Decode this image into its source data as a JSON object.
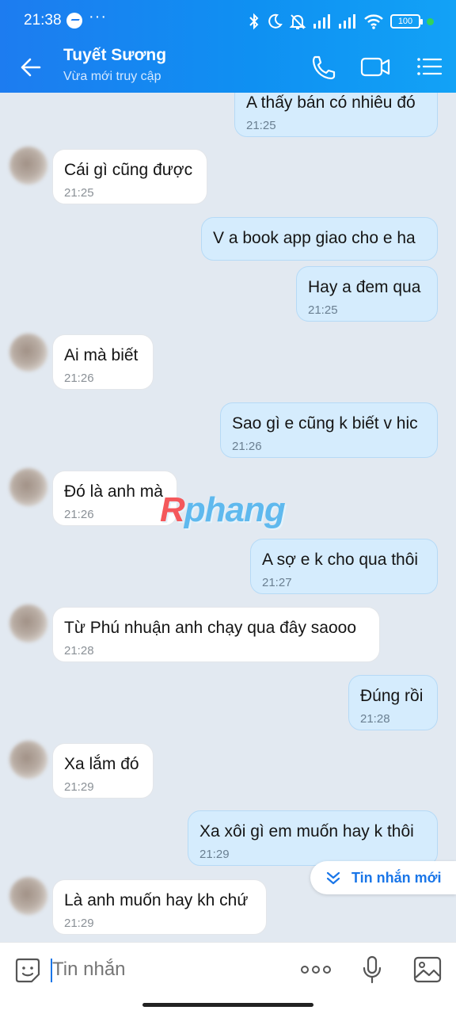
{
  "status_bar": {
    "time": "21:38",
    "more": "···",
    "battery": "100"
  },
  "header": {
    "contact_name": "Tuyết Sương",
    "contact_status": "Vừa mới truy cập"
  },
  "messages": [
    {
      "dir": "out",
      "text": "A thấy bán có nhiêu đó",
      "time": "21:25"
    },
    {
      "dir": "in",
      "text": "Cái gì cũng được",
      "time": "21:25"
    },
    {
      "dir": "out",
      "text": "V a book app giao cho e ha",
      "time": ""
    },
    {
      "dir": "out",
      "text": "Hay a đem qua",
      "time": "21:25"
    },
    {
      "dir": "in",
      "text": "Ai mà biết",
      "time": "21:26"
    },
    {
      "dir": "out",
      "text": "Sao gì e cũng k biết v hic",
      "time": "21:26"
    },
    {
      "dir": "in",
      "text": "Đó là anh mà",
      "time": "21:26"
    },
    {
      "dir": "out",
      "text": "A sợ e k cho qua thôi",
      "time": "21:27"
    },
    {
      "dir": "in",
      "text": "Từ Phú nhuận anh chạy qua đây saooo",
      "time": "21:28"
    },
    {
      "dir": "out",
      "text": "Đúng rồi",
      "time": "21:28"
    },
    {
      "dir": "in",
      "text": "Xa lắm đó",
      "time": "21:29"
    },
    {
      "dir": "out",
      "text": "Xa xôi gì em muốn hay k thôi",
      "time": "21:29"
    },
    {
      "dir": "in",
      "text": "Là anh muốn hay kh chứ",
      "time": "21:29"
    }
  ],
  "watermark": {
    "first": "R",
    "rest": "phang"
  },
  "new_message_button": "Tin nhắn mới",
  "composer": {
    "placeholder": "Tin nhắn"
  },
  "colors": {
    "header_blue": "#1d7cf0",
    "outgoing_bubble": "#d5ecfd",
    "incoming_bubble": "#ffffff",
    "chat_background": "#e2e9f1",
    "accent": "#1a76e8"
  },
  "icons": {
    "back": "arrow-left-icon",
    "call": "phone-icon",
    "video": "video-camera-icon",
    "menu": "list-menu-icon",
    "emoji": "sticker-icon",
    "more": "more-dots-icon",
    "mic": "microphone-icon",
    "image": "image-icon",
    "new_message": "chevrons-down-icon"
  }
}
